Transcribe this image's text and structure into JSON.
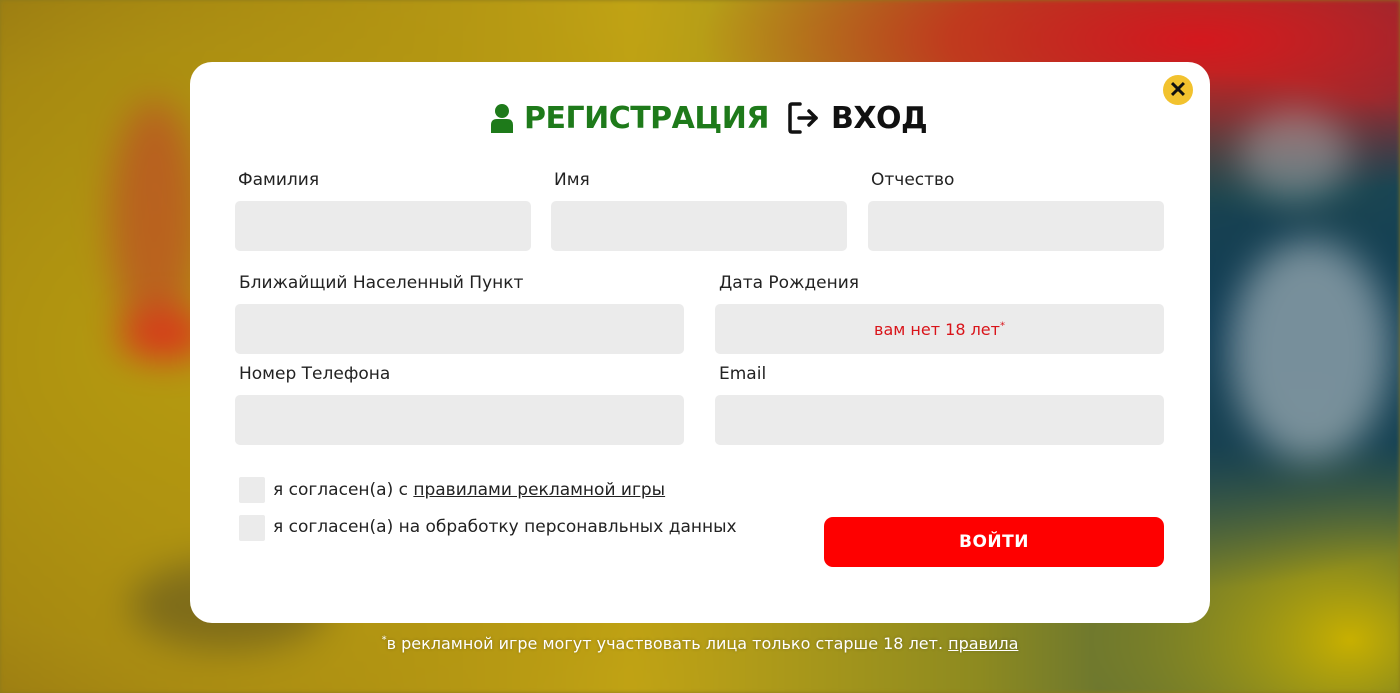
{
  "colors": {
    "accent_green": "#1e7a1a",
    "button_red": "#fe0000",
    "error_red": "#d9141a",
    "field_bg": "#ebebeb",
    "close_yellow": "#f2c22e"
  },
  "modal": {
    "close_icon": "close-icon",
    "tabs": {
      "register": {
        "icon": "user-icon",
        "label": "РЕГИСТРАЦИЯ"
      },
      "login": {
        "icon": "login-arrow-icon",
        "label": "ВХОД"
      }
    },
    "form": {
      "last_name": {
        "label": "Фамилия",
        "value": ""
      },
      "first_name": {
        "label": "Имя",
        "value": ""
      },
      "patronymic": {
        "label": "Отчество",
        "value": ""
      },
      "locality": {
        "label": "Ближайщий Населенный Пункт",
        "value": ""
      },
      "birth_date": {
        "label": "Дата Рождения",
        "error": "вам нет 18 лет",
        "error_mark": "*"
      },
      "phone": {
        "label": "Номер Телефона",
        "value": ""
      },
      "email": {
        "label": "Email",
        "value": ""
      }
    },
    "consents": {
      "rules_prefix": "я согласен(а) с ",
      "rules_link": "правилами рекламной игры",
      "personal_data": "я согласен(а) на обработку персонавльных данных"
    },
    "submit_label": "ВОЙТИ"
  },
  "footnote": {
    "mark": "*",
    "text": "в рекламной игре могут участвовать лица только старше 18 лет. ",
    "link": "правила"
  }
}
